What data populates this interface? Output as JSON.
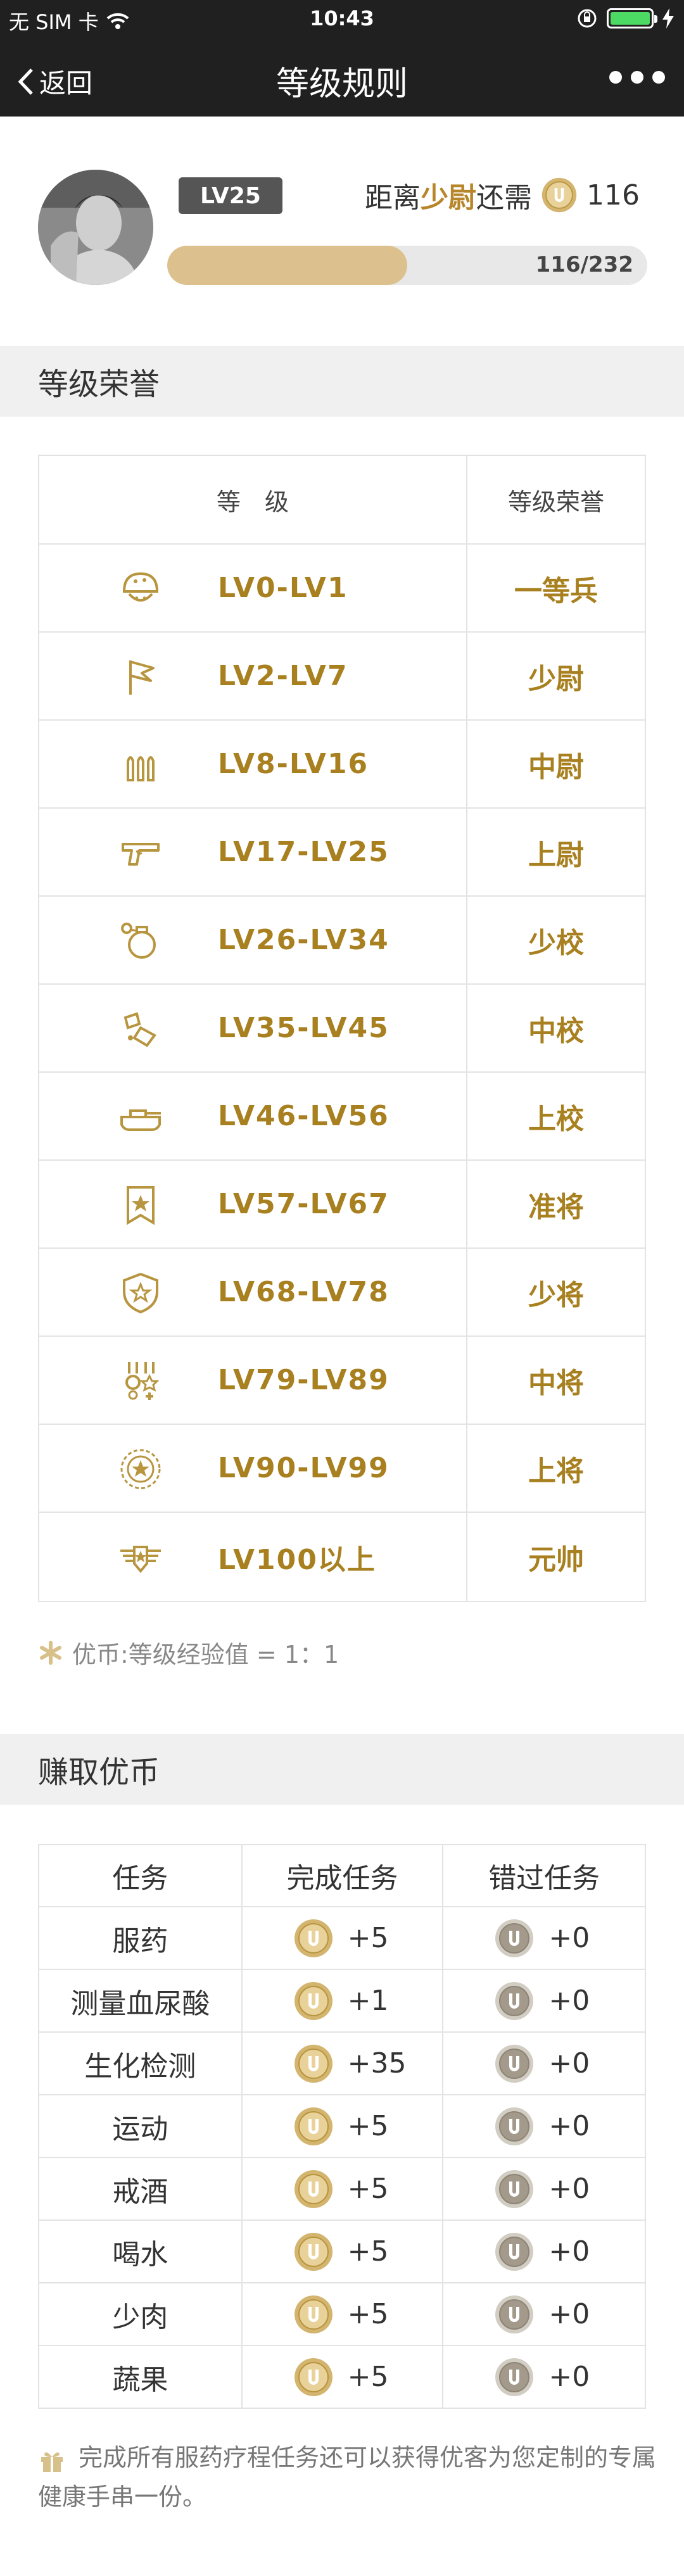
{
  "status_bar": {
    "carrier": "无 SIM 卡",
    "time": "10:43"
  },
  "nav": {
    "back_label": "返回",
    "title": "等级规则"
  },
  "profile": {
    "level_badge": "LV25",
    "promo_prefix": "距离",
    "promo_rank": "少尉",
    "promo_suffix": "还需",
    "coins_needed": "116",
    "progress_text": "116/232",
    "progress_fraction": 0.5
  },
  "honor_section": {
    "title": "等级荣誉",
    "col_level": "等　级",
    "col_honor": "等级荣誉",
    "rows": [
      {
        "icon": "helmet-icon",
        "range": "LV0-LV1",
        "rank": "一等兵"
      },
      {
        "icon": "flag-icon",
        "range": "LV2-LV7",
        "rank": "少尉"
      },
      {
        "icon": "bullets-icon",
        "range": "LV8-LV16",
        "rank": "中尉"
      },
      {
        "icon": "pistol-icon",
        "range": "LV17-LV25",
        "rank": "上尉"
      },
      {
        "icon": "grenade-icon",
        "range": "LV26-LV34",
        "rank": "少校"
      },
      {
        "icon": "bomb-icon",
        "range": "LV35-LV45",
        "rank": "中校"
      },
      {
        "icon": "tank-icon",
        "range": "LV46-LV56",
        "rank": "上校"
      },
      {
        "icon": "star-ribbon-icon",
        "range": "LV57-LV67",
        "rank": "准将"
      },
      {
        "icon": "shield-star-icon",
        "range": "LV68-LV78",
        "rank": "少将"
      },
      {
        "icon": "medals-icon",
        "range": "LV79-LV89",
        "rank": "中将"
      },
      {
        "icon": "laurel-star-icon",
        "range": "LV90-LV99",
        "rank": "上将"
      },
      {
        "icon": "winged-star-icon",
        "range": "LV100以上",
        "rank": "元帅"
      }
    ],
    "note": "优币:等级经验值 = 1：1"
  },
  "coin_section": {
    "title": "赚取优币",
    "col_task": "任务",
    "col_done": "完成任务",
    "col_missed": "错过任务",
    "rows": [
      {
        "task": "服药",
        "done": "+5",
        "missed": "+0"
      },
      {
        "task": "测量血尿酸",
        "done": "+1",
        "missed": "+0"
      },
      {
        "task": "生化检测",
        "done": "+35",
        "missed": "+0"
      },
      {
        "task": "运动",
        "done": "+5",
        "missed": "+0"
      },
      {
        "task": "戒酒",
        "done": "+5",
        "missed": "+0"
      },
      {
        "task": "喝水",
        "done": "+5",
        "missed": "+0"
      },
      {
        "task": "少肉",
        "done": "+5",
        "missed": "+0"
      },
      {
        "task": "蔬果",
        "done": "+5",
        "missed": "+0"
      }
    ],
    "footer": "完成所有服药疗程任务还可以获得优客为您定制的专属健康手串一份。"
  },
  "colors": {
    "accent": "#a8801f",
    "progress": "#dcc18f",
    "bar": "#202020"
  }
}
